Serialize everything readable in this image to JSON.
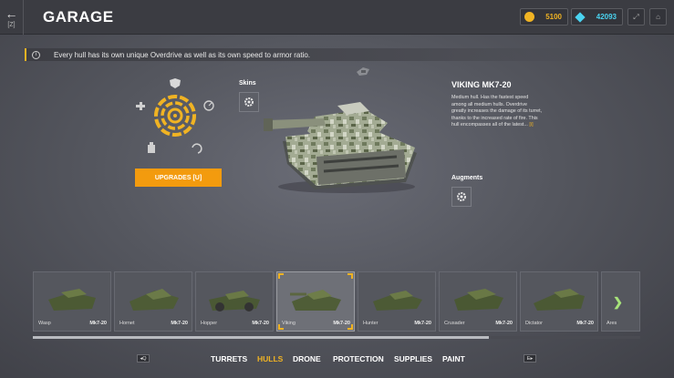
{
  "header": {
    "back_key": "[Z]",
    "title": "GARAGE",
    "crystals": "5100",
    "diamonds": "42093",
    "colors": {
      "crystals": "#f0b323",
      "diamonds": "#4ad3f0"
    },
    "icons": [
      "crystal-icon",
      "diamond-icon",
      "fullscreen-icon",
      "exit-icon"
    ]
  },
  "tip": {
    "text": "Every hull has its own unique Overdrive as well as its own speed to armor ratio."
  },
  "left_panel": {
    "skins_label": "Skins",
    "upgrades_button": "UPGRADES [U]",
    "accent": "#f39b0e"
  },
  "hull": {
    "name": "VIKING MK7-20",
    "description": "Medium hull. Has the fastest speed among all medium hulls. Overdrive greatly increases the damage of its turret, thanks to the increased rate of fire. This hull encompasses all of the latest...",
    "more": "[i]",
    "augments_label": "Augments"
  },
  "carousel": {
    "cards": [
      {
        "name": "Wasp",
        "mk": "Mk7-20"
      },
      {
        "name": "Hornet",
        "mk": "Mk7-20"
      },
      {
        "name": "Hopper",
        "mk": "Mk7-20"
      },
      {
        "name": "Viking",
        "mk": "Mk7-20"
      },
      {
        "name": "Hunter",
        "mk": "Mk7-20"
      },
      {
        "name": "Crusader",
        "mk": "Mk7-20"
      },
      {
        "name": "Dictator",
        "mk": "Mk7-20"
      },
      {
        "name": "Ares",
        "mk": ""
      }
    ],
    "selected_index": 3
  },
  "bottom_nav": {
    "prev_key": "Q",
    "next_key": "E",
    "tabs": [
      "TURRETS",
      "HULLS",
      "DRONE",
      "PROTECTION",
      "SUPPLIES",
      "PAINT"
    ],
    "active": "HULLS"
  }
}
